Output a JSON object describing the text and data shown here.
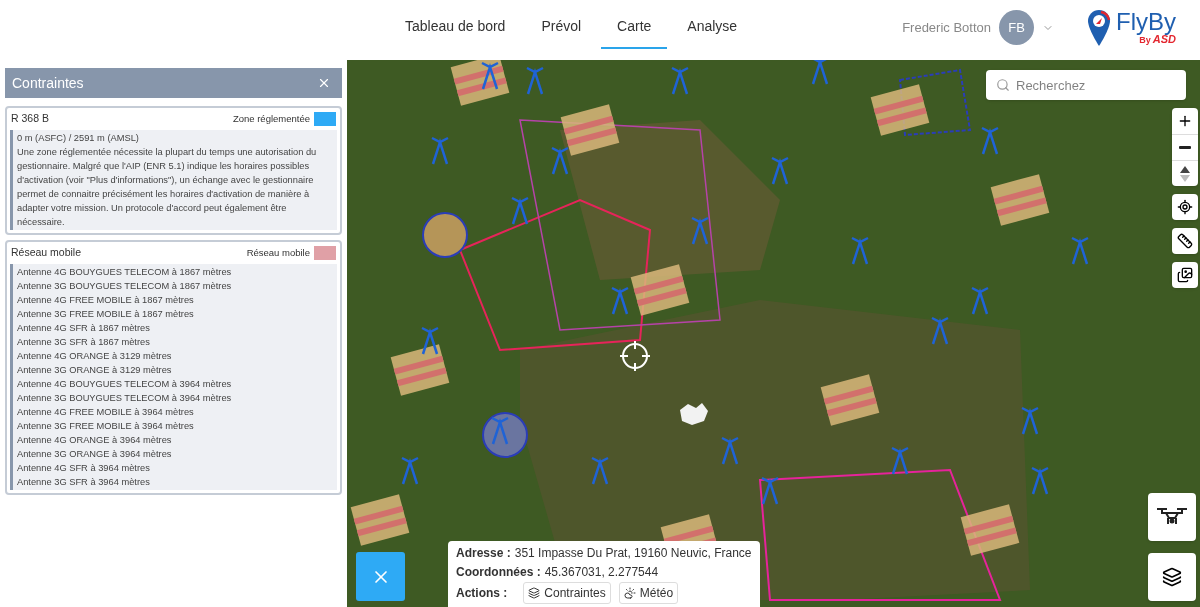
{
  "nav": {
    "tabs": [
      {
        "label": "Tableau de bord",
        "selected": false
      },
      {
        "label": "Prévol",
        "selected": false
      },
      {
        "label": "Carte",
        "selected": true
      },
      {
        "label": "Analyse",
        "selected": false
      }
    ],
    "user": {
      "name": "Frederic Botton",
      "initials": "FB"
    },
    "logo": {
      "name": "FlyBy",
      "by": "By",
      "brand": "ASD"
    }
  },
  "panel": {
    "title": "Contraintes",
    "constraints": [
      {
        "title": "R 368 B",
        "legend": "Zone réglementée",
        "color": "#2eaaf5",
        "lines": [
          "0 m (ASFC) / 2591 m (AMSL)",
          "Une zone réglementée nécessite la plupart du temps une autorisation du gestionnaire. Malgré que l'AIP (ENR 5.1) indique les horaires possibles d'activation (voir \"Plus d'informations\"), un échange avec le gestionnaire permet de connaitre précisément les horaires d'activation de manière à adapter votre mission. Un protocole d'accord peut également être nécessaire."
        ]
      },
      {
        "title": "Réseau mobile",
        "legend": "Réseau mobile",
        "color": "#e0a0a6",
        "lines": [
          "Antenne 4G BOUYGUES TELECOM à 1867 mètres",
          "Antenne 3G BOUYGUES TELECOM à 1867 mètres",
          "Antenne 4G FREE MOBILE à 1867 mètres",
          "Antenne 3G FREE MOBILE à 1867 mètres",
          "Antenne 4G SFR à 1867 mètres",
          "Antenne 3G SFR à 1867 mètres",
          "Antenne 4G ORANGE à 3129 mètres",
          "Antenne 3G ORANGE à 3129 mètres",
          "Antenne 4G BOUYGUES TELECOM à 3964 mètres",
          "Antenne 3G BOUYGUES TELECOM à 3964 mètres",
          "Antenne 4G FREE MOBILE à 3964 mètres",
          "Antenne 3G FREE MOBILE à 3964 mètres",
          "Antenne 4G ORANGE à 3964 mètres",
          "Antenne 3G ORANGE à 3964 mètres",
          "Antenne 4G SFR à 3964 mètres",
          "Antenne 3G SFR à 3964 mètres"
        ]
      }
    ]
  },
  "map": {
    "search": {
      "placeholder": "Recherchez"
    },
    "info": {
      "fields": [
        {
          "label": "Adresse :",
          "value": "351 Impasse Du Prat, 19160 Neuvic, France"
        },
        {
          "label": "Coordonnées :",
          "value": "45.367031, 2.277544"
        }
      ],
      "actions_label": "Actions :",
      "actions": [
        {
          "kind": "layers",
          "label": "Contraintes"
        },
        {
          "kind": "weather",
          "label": "Météo"
        }
      ]
    }
  }
}
